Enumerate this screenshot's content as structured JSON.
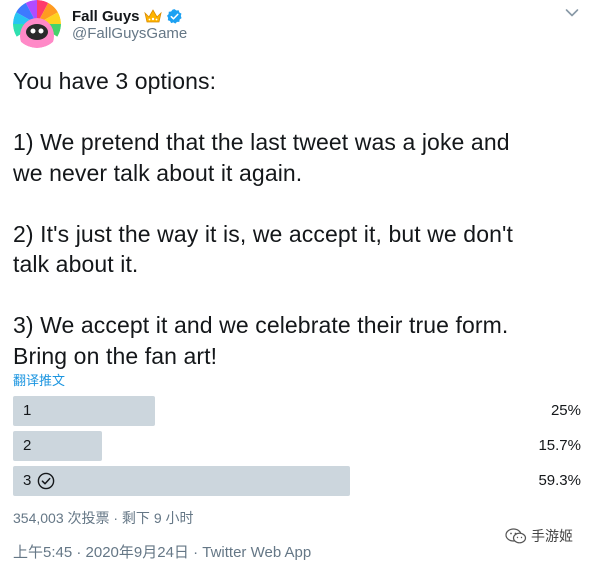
{
  "header": {
    "display_name": "Fall Guys",
    "handle": "@FallGuysGame",
    "accent": "#1da1f2"
  },
  "tweet": {
    "text": "You have 3 options:\n\n1) We pretend that the last tweet was a joke and\nwe never talk about it again.\n\n2) It's just the way it is, we accept it, but we don't\ntalk about it.\n\n3) We accept it and we celebrate their true form.\nBring on the fan art!",
    "translate_label": "翻译推文"
  },
  "poll": {
    "options": [
      {
        "label": "1",
        "percent_label": "25%",
        "percent": 25,
        "winner": false
      },
      {
        "label": "2",
        "percent_label": "15.7%",
        "percent": 15.7,
        "winner": false
      },
      {
        "label": "3",
        "percent_label": "59.3%",
        "percent": 59.3,
        "winner": true
      }
    ],
    "meta": "354,003 次投票 · 剩下 9 小时"
  },
  "timestamp": "上午5:45 · 2020年9月24日 · Twitter Web App",
  "watermark": {
    "label": "手游姬",
    "icon": "wechat-logo-icon"
  },
  "colors": {
    "bar": "#ccd6dd",
    "link": "#1b95e0",
    "secondary_text": "#657786"
  }
}
